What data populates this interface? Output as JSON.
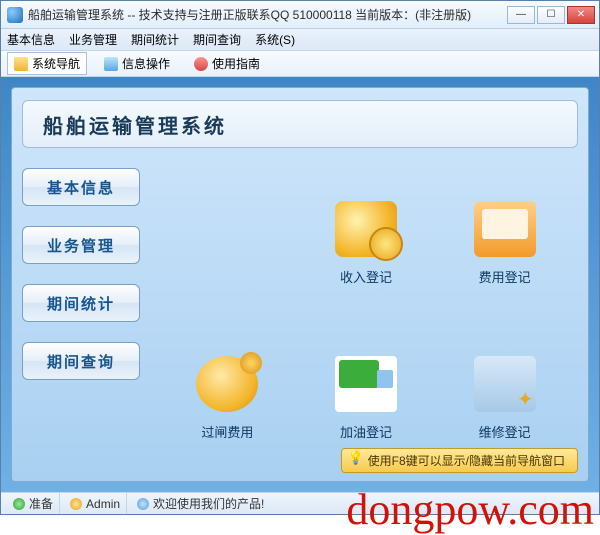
{
  "window": {
    "title": "船舶运输管理系统 -- 技术支持与注册正版联系QQ 510000118   当前版本：(非注册版)"
  },
  "menu": {
    "basic": "基本信息",
    "biz": "业务管理",
    "stats": "期间统计",
    "query": "期间查询",
    "system": "系统(S)"
  },
  "toolbar": {
    "nav": "系统导航",
    "info": "信息操作",
    "guide": "使用指南"
  },
  "panel": {
    "title": "船舶运输管理系统"
  },
  "sidenav": {
    "basic": "基本信息",
    "biz": "业务管理",
    "stats": "期间统计",
    "query": "期间查询"
  },
  "dash": {
    "income": "收入登记",
    "expense": "费用登记",
    "lock": "过闸费用",
    "fuel": "加油登记",
    "repair": "维修登记"
  },
  "hint": "使用F8键可以显示/隐藏当前导航窗口",
  "status": {
    "ready": "准备",
    "user": "Admin",
    "welcome": "欢迎使用我们的产品!"
  },
  "watermark": "dongpow.com"
}
